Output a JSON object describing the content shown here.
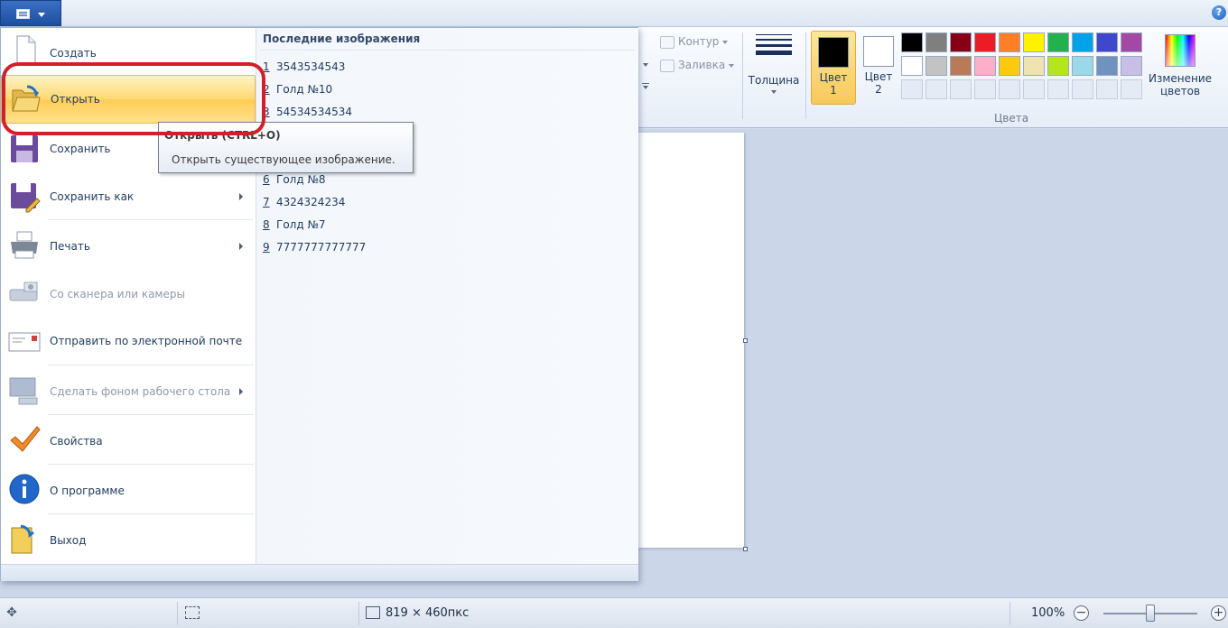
{
  "menu": {
    "items": [
      {
        "label": "Создать"
      },
      {
        "label": "Открыть"
      },
      {
        "label": "Сохранить"
      },
      {
        "label": "Сохранить как"
      },
      {
        "label": "Печать"
      },
      {
        "label": "Со сканера или камеры"
      },
      {
        "label": "Отправить по электронной почте"
      },
      {
        "label": "Сделать фоном рабочего стола"
      },
      {
        "label": "Свойства"
      },
      {
        "label": "О программе"
      },
      {
        "label": "Выход"
      }
    ],
    "recent_title": "Последние изображения",
    "recent": [
      {
        "num": "1",
        "name": "3543534543"
      },
      {
        "num": "2",
        "name": "Голд №10"
      },
      {
        "num": "3",
        "name": "54534534534"
      },
      {
        "num": "6",
        "name": "Голд №8"
      },
      {
        "num": "7",
        "name": "4324324234"
      },
      {
        "num": "8",
        "name": "Голд №7"
      },
      {
        "num": "9",
        "name": "7777777777777"
      }
    ]
  },
  "tooltip": {
    "title": "Открыть (CTRL+O)",
    "description": "Открыть существующее изображение."
  },
  "ribbon": {
    "outline_label": "Контур",
    "fill_label": "Заливка",
    "thickness_label": "Толщина",
    "color1_label_a": "Цвет",
    "color1_label_b": "1",
    "color2_label_a": "Цвет",
    "color2_label_b": "2",
    "edit_colors_a": "Изменение",
    "edit_colors_b": "цветов",
    "colors_group": "Цвета",
    "color1": "#000000",
    "color2": "#ffffff",
    "palette_row1": [
      "#000000",
      "#7f7f7f",
      "#880015",
      "#ed1c24",
      "#ff7f27",
      "#fff200",
      "#22b14c",
      "#00a2e8",
      "#3f48cc",
      "#a349a4"
    ],
    "palette_row2": [
      "#ffffff",
      "#c3c3c3",
      "#b97a57",
      "#ffaec9",
      "#ffc90e",
      "#efe4b0",
      "#b5e61d",
      "#99d9ea",
      "#7092be",
      "#c8bfe7"
    ]
  },
  "status": {
    "image_size": "819 × 460пкс",
    "zoom": "100%",
    "zoom_fraction": 0.5
  }
}
